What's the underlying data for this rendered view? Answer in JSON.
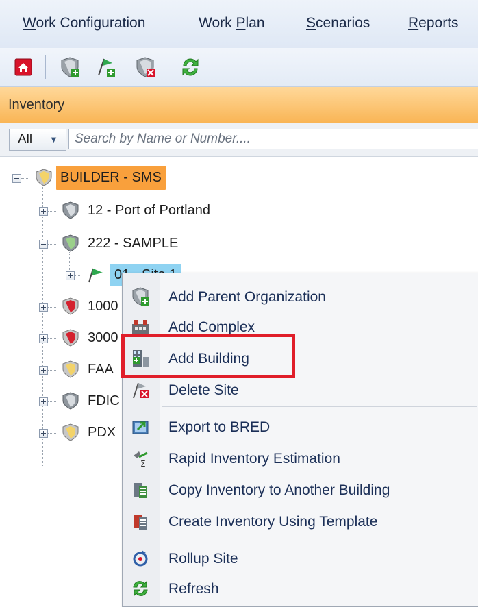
{
  "menubar": {
    "items": [
      {
        "pre": "",
        "ul": "W",
        "post": "ork Configuration"
      },
      {
        "pre": "Work ",
        "ul": "P",
        "post": "lan"
      },
      {
        "pre": "",
        "ul": "S",
        "post": "cenarios"
      },
      {
        "pre": "",
        "ul": "R",
        "post": "eports"
      }
    ]
  },
  "toolbar": {
    "buttons": [
      "home-icon",
      "add-organization-icon",
      "add-site-icon",
      "delete-organization-icon",
      "refresh-icon"
    ]
  },
  "panel": {
    "title": "Inventory"
  },
  "search": {
    "scope_value": "All",
    "placeholder": "Search by Name or Number...."
  },
  "tree": {
    "root": "BUILDER - SMS",
    "nodes": [
      "12 - Port of Portland",
      "222 - SAMPLE",
      "01 - Site 1",
      "1000",
      "3000",
      "FAA",
      "FDIC",
      "PDX"
    ]
  },
  "context_menu": {
    "items": [
      "Add Parent Organization",
      "Add Complex",
      "Add Building",
      "Delete Site",
      "Export to BRED",
      "Rapid Inventory Estimation",
      "Copy Inventory to Another Building",
      "Create Inventory Using Template",
      "Rollup Site",
      "Refresh"
    ]
  },
  "colors": {
    "header_orange": "#f9b555",
    "root_highlight": "#f9a03c",
    "selection_blue": "#8fd3f2",
    "annotation_red": "#e01e2a"
  }
}
